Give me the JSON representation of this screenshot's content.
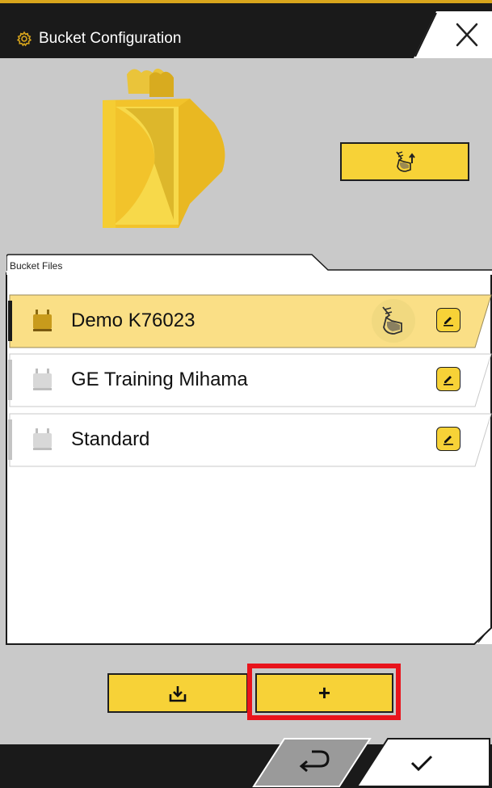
{
  "header": {
    "title": "Bucket Configuration",
    "icon": "gear-icon",
    "close_icon": "close-icon"
  },
  "preview": {
    "bucket_color": "#f2c32b",
    "select_bucket_icon": "bucket-select-icon"
  },
  "files": {
    "tab_label": "Bucket Files",
    "items": [
      {
        "name": "Demo K76023",
        "selected": true,
        "active": true
      },
      {
        "name": "GE Training Mihama",
        "selected": false,
        "active": false
      },
      {
        "name": "Standard",
        "selected": false,
        "active": false
      }
    ]
  },
  "actions": {
    "import_icon": "import-icon",
    "add_label": "+"
  },
  "footer": {
    "back_icon": "return-icon",
    "confirm_icon": "check-icon"
  },
  "colors": {
    "accent": "#f7d237",
    "selected_row": "#fadf86",
    "header": "#1a1a1a",
    "background": "#c9c9c9",
    "highlight": "#e8141c"
  }
}
